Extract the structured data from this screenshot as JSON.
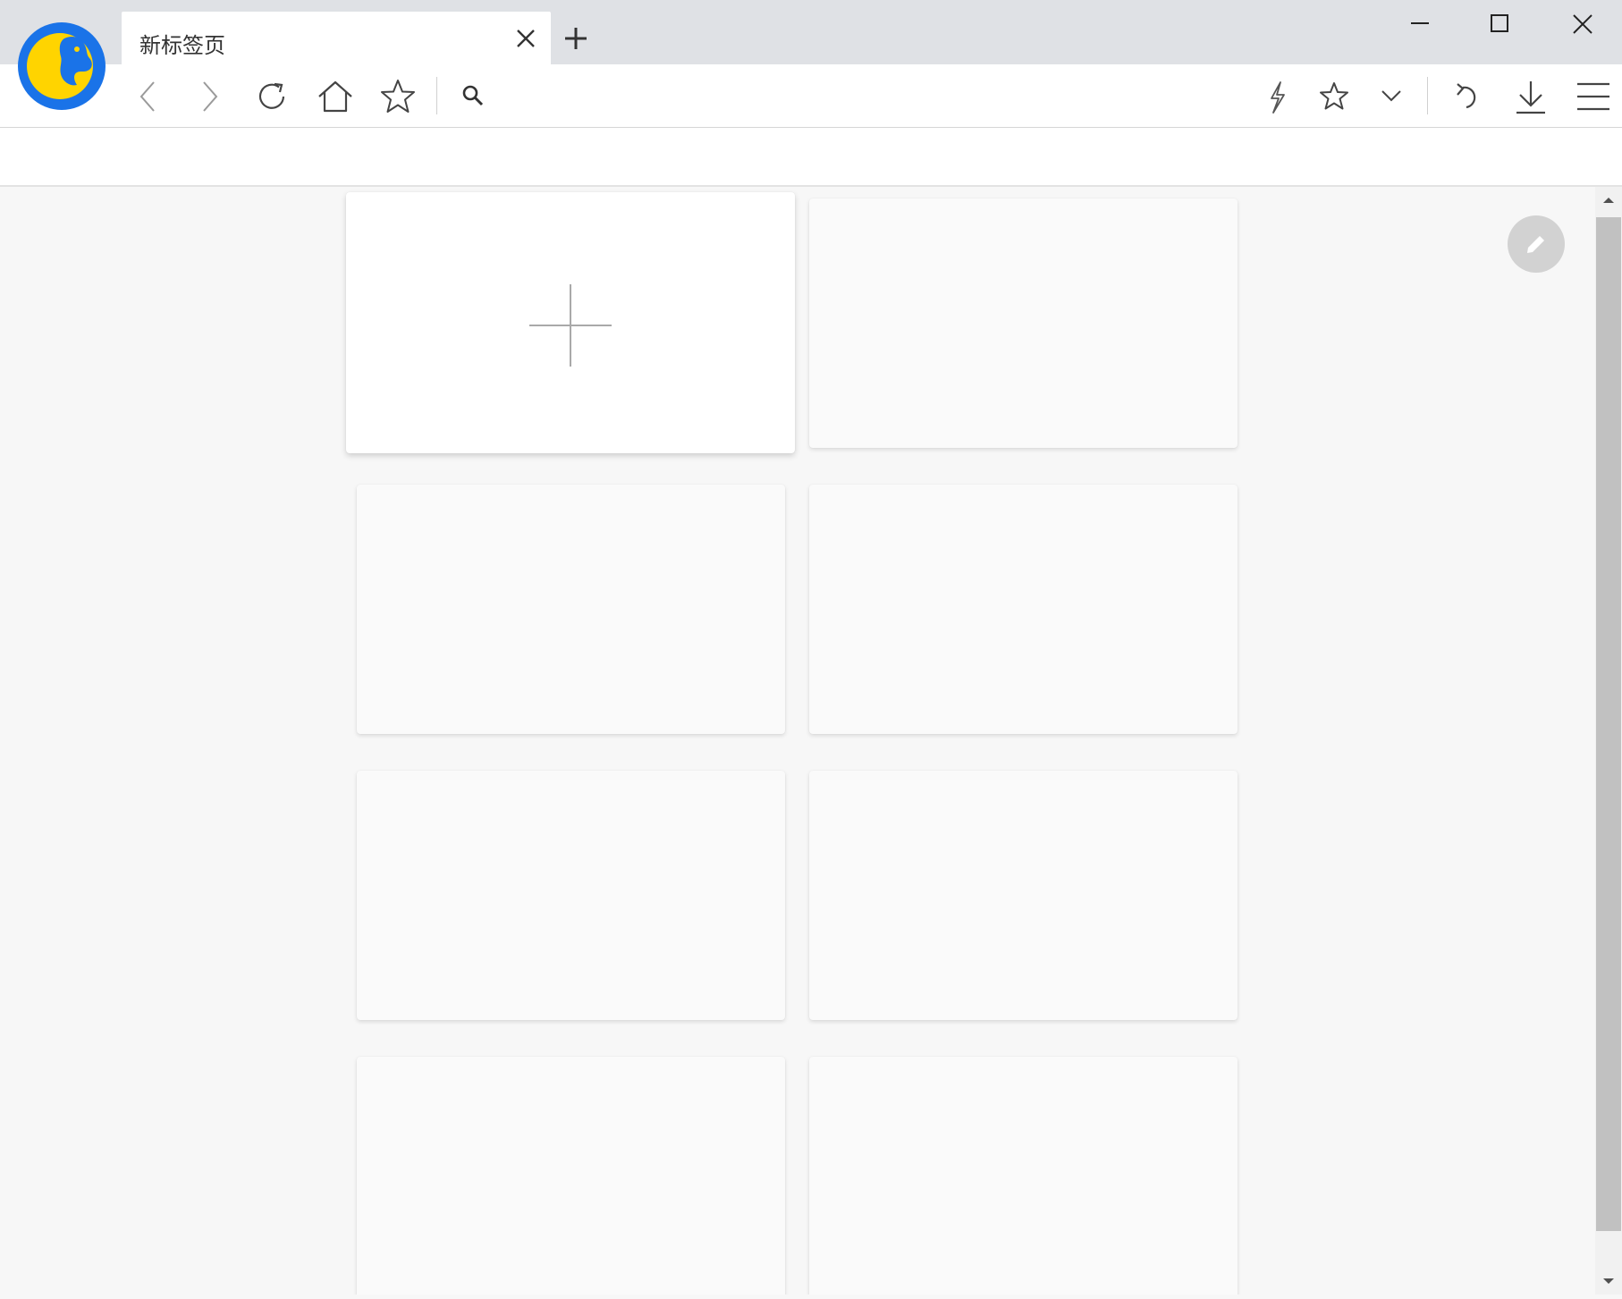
{
  "browser": {
    "logo": "browser-logo",
    "tab": {
      "title": "新标签页",
      "close_icon": "close-icon"
    },
    "new_tab_icon": "plus-icon",
    "window_controls": [
      "minimize-icon",
      "maximize-icon",
      "close-icon"
    ]
  },
  "toolbar": {
    "left": [
      "back-icon",
      "forward-icon",
      "reload-icon",
      "home-icon",
      "star-icon",
      "search-icon"
    ],
    "right": [
      "lightning-icon",
      "star-icon",
      "chevron-down-icon",
      "undo-icon",
      "download-icon",
      "menu-icon"
    ]
  },
  "new_tab_page": {
    "add_tile_icon": "plus-icon",
    "tile_count": 8,
    "edit_icon": "pencil-icon"
  },
  "colors": {
    "tabstrip": "#dfe1e5",
    "logo_blue": "#1a73e8",
    "logo_yellow": "#ffd400",
    "page_background": "#f7f7f7",
    "edit_button": "#d2d2d2"
  }
}
